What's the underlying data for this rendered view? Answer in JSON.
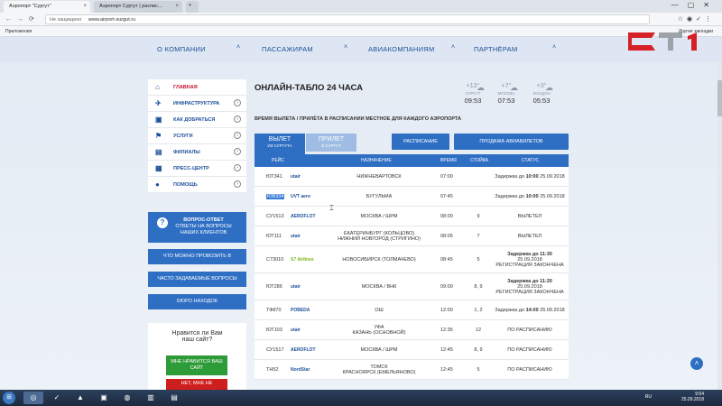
{
  "browser": {
    "tabs": [
      {
        "label": "Аэропорт \"Сургут\"",
        "active": true
      },
      {
        "label": "Аэропорт Сургут | распис...",
        "active": false
      }
    ],
    "url_security": "Не защищено",
    "url": "www.airport-surgut.ru",
    "bookmarks_label": "Приложения",
    "other_bookmarks": "Другие закладки"
  },
  "nav": {
    "items": [
      "О КОМПАНИИ",
      "ПАССАЖИРАМ",
      "АВИАКОМПАНИЯМ",
      "ПАРТНЁРАМ"
    ]
  },
  "sidebar": {
    "items": [
      {
        "label": "ГЛАВНАЯ",
        "icon": "home-icon",
        "has_arrow": false,
        "active": true
      },
      {
        "label": "ИНФРАСТРУКТУРА",
        "icon": "plane-icon",
        "has_arrow": true
      },
      {
        "label": "КАК ДОБРАТЬСЯ",
        "icon": "bus-icon",
        "has_arrow": true
      },
      {
        "label": "УСЛУГИ",
        "icon": "services-icon",
        "has_arrow": true
      },
      {
        "label": "ФИЛИАЛЫ",
        "icon": "branches-icon",
        "has_arrow": true
      },
      {
        "label": "ПРЕСС-ЦЕНТР",
        "icon": "press-icon",
        "has_arrow": true
      },
      {
        "label": "ПОМОЩЬ",
        "icon": "help-person-icon",
        "has_arrow": true
      }
    ],
    "qa_title": "ВОПРОС-ОТВЕТ",
    "qa_text1": "ОТВЕТЫ НА ВОПРОСЫ",
    "qa_text2": "НАШИХ КЛИЕНТОВ",
    "buttons": [
      "ЧТО МОЖНО ПРОВОЗИТЬ В САМОЛЁТЕ?",
      "ЧАСТО ЗАДАВАЕМЫЕ ВОПРОСЫ",
      "БЮРО НАХОДОК"
    ],
    "like_q1": "Нравится ли Вам",
    "like_q2": "наш сайт?",
    "like_yes1": "МНЕ НРАВИТСЯ ВАШ",
    "like_yes2": "САЙТ",
    "like_no": "НЕТ, МНЕ НЕ"
  },
  "main": {
    "title": "ОНЛАЙН-ТАБЛО 24 ЧАСА",
    "subtitle": "ВРЕМЯ ВЫЛЕТА / ПРИЛЁТА В РАСПИСАНИИ МЕСТНОЕ ДЛЯ КАЖДОГО АЭРОПОРТА",
    "weather": [
      {
        "temp": "+13°",
        "city": "СУРГУТ",
        "time": "09:53"
      },
      {
        "temp": "+7°",
        "city": "МОСКВА",
        "time": "07:53"
      },
      {
        "temp": "+3°",
        "city": "ЛОНДОН",
        "time": "05:53"
      }
    ],
    "tab_departure": "ВЫЛЕТ",
    "tab_departure_sub": "ИЗ СУРГУТА",
    "tab_arrival": "ПРИЛЕТ",
    "tab_arrival_sub": "В СУРГУТ",
    "btn_schedule": "РАСПИСАНИЕ",
    "btn_tickets": "ПРОДАЖА АВИАБИЛЕТОВ"
  },
  "table": {
    "headers": {
      "flight": "РЕЙС",
      "destination": "НАЗНАЧЕНИЕ",
      "time": "ВРЕМЯ",
      "gate": "СТОЙКА",
      "status": "СТАТУС"
    },
    "rows": [
      {
        "flight": "ЮТ341",
        "airline": "utair",
        "dest1": "НИЖНЕВАРТОВСК",
        "dest2": "",
        "time": "07:00",
        "gate": "",
        "status_pre": "Задержка до",
        "status_bold": "10:00",
        "status_post": "25.09.2018",
        "status2": ""
      },
      {
        "flight": "ЮВ334",
        "airline": "UVT aero",
        "dest1": "БУГУЛЬМА",
        "dest2": "",
        "time": "07:45",
        "gate": "",
        "status_pre": "Задержка до",
        "status_bold": "10:00",
        "status_post": "25.09.2018",
        "status2": "",
        "selected": true
      },
      {
        "flight": "СУ1513",
        "airline": "AEROFLOT",
        "dest1": "МОСКВА / ШРМ",
        "dest2": "",
        "time": "08:00",
        "gate": "9",
        "status_pre": "ВЫЛЕТЕЛ",
        "status_bold": "",
        "status_post": "",
        "status2": ""
      },
      {
        "flight": "ЮТ111",
        "airline": "utair",
        "dest1": "ЕКАТЕРИНБУРГ (КОЛЬЦОВО)",
        "dest2": "НИЖНИЙ НОВГОРОД (СТРИГИНО)",
        "time": "08:05",
        "gate": "7",
        "status_pre": "ВЫЛЕТЕЛ",
        "status_bold": "",
        "status_post": "",
        "status2": ""
      },
      {
        "flight": "С73010",
        "airline": "S7 Airlines",
        "dest1": "НОВОСИБИРСК (ТОЛМАЧЕВО)",
        "dest2": "",
        "time": "08:45",
        "gate": "5",
        "status_pre": "",
        "status_bold": "Задержка до 11:30",
        "status_post": "25.09.2018",
        "status2": "РЕГИСТРАЦИЯ ЗАКОНЧЕНА"
      },
      {
        "flight": "ЮТ286",
        "airline": "utair",
        "dest1": "МОСКВА / ВНК",
        "dest2": "",
        "time": "09:00",
        "gate": "8, 9",
        "status_pre": "",
        "status_bold": "Задержка до 11:20",
        "status_post": "25.09.2018",
        "status2": "РЕГИСТРАЦИЯ ЗАКОНЧЕНА"
      },
      {
        "flight": "ТФ870",
        "airline": "POBEDA",
        "dest1": "ОШ",
        "dest2": "",
        "time": "12:00",
        "gate": "1, 2",
        "status_pre": "Задержка до",
        "status_bold": "14:00",
        "status_post": "25.09.2018",
        "status2": ""
      },
      {
        "flight": "ЮТ103",
        "airline": "utair",
        "dest1": "УФА",
        "dest2": "КАЗАНЬ (ОСНОВНОЙ)",
        "time": "12:35",
        "gate": "12",
        "status_pre": "ПО РАСПИСАНИЮ",
        "status_bold": "",
        "status_post": "",
        "status2": ""
      },
      {
        "flight": "СУ1517",
        "airline": "AEROFLOT",
        "dest1": "МОСКВА / ШРМ",
        "dest2": "",
        "time": "12:45",
        "gate": "8, 9",
        "status_pre": "ПО РАСПИСАНИЮ",
        "status_bold": "",
        "status_post": "",
        "status2": ""
      },
      {
        "flight": "ТН52",
        "airline": "NordStar",
        "dest1": "ТОМСК",
        "dest2": "КРАСНОЯРСК (ЕМЕЛЬЯНОВО)",
        "time": "12:45",
        "gate": "5",
        "status_pre": "ПО РАСПИСАНИЮ",
        "status_bold": "",
        "status_post": "",
        "status2": ""
      }
    ]
  },
  "taskbar": {
    "lang": "RU",
    "clock_time": "9:54",
    "clock_date": "25.09.2018"
  },
  "colors": {
    "brand_blue": "#2e6fc4",
    "accent_red": "#c8102e",
    "green": "#2e9b39"
  }
}
